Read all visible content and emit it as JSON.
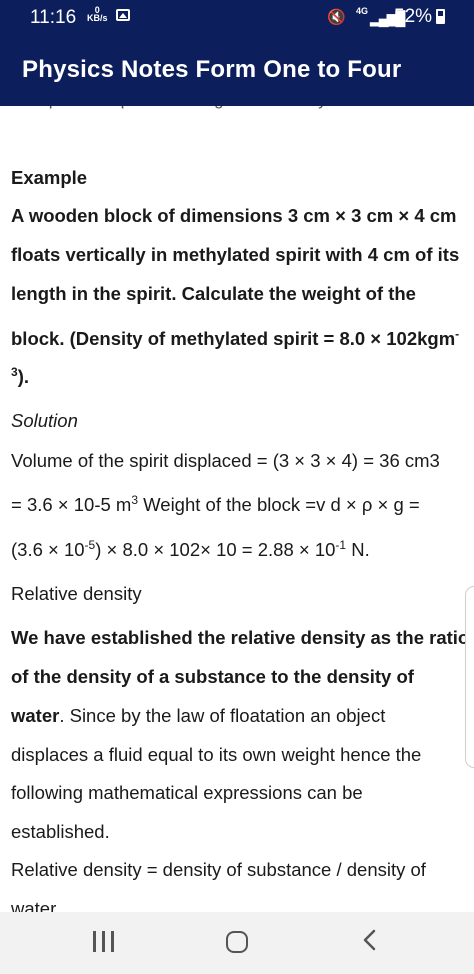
{
  "status_bar": {
    "time": "11:16",
    "net_speed_value": "0",
    "net_speed_unit": "KB/s",
    "network": "4G",
    "battery": "52%"
  },
  "app_bar": {
    "title": "Physics Notes Form One to Four"
  },
  "content": {
    "cut_line": "the upthrust equals the weight of the body.",
    "example_heading": "Example",
    "example_lines": [
      "A wooden block of dimensions 3 cm × 3 cm × 4 cm",
      "floats vertically in methylated spirit with 4 cm of its",
      "length in the spirit. Calculate the weight of the",
      "block. (Density of methylated spirit = 8.0 × 102kgm"
    ],
    "example_sup": "-",
    "example_last_sup": "3",
    "example_last_tail": ").",
    "solution_label": "Solution",
    "sol_line1": "Volume of the spirit displaced = (3 × 3 × 4) = 36 cm3",
    "sol_line2_a": "= 3.6 × 10-5 m",
    "sol_line2_sup": "3",
    "sol_line2_b": " Weight of the block =v d × ρ × g =",
    "sol_line3_a": "(3.6 × 10",
    "sol_line3_sup1": "-5",
    "sol_line3_b": ") × 8.0 × 102× 10 = 2.88 × 10",
    "sol_line3_sup2": "-1",
    "sol_line3_c": " N.",
    "relative_density_heading": "Relative density",
    "rd_bold_1": "We have established the relative density as the ratio",
    "rd_bold_2": "of the density of a substance to the density of",
    "rd_bold_3": "water",
    "rd_plain_3": ". Since by the law of floatation an object",
    "rd_line4": "displaces a fluid equal to its own weight hence the",
    "rd_line5": "following mathematical expressions can be",
    "rd_line6": "established.",
    "rd_formula": "Relative density = density of substance / density of",
    "rd_formula_cut": "water"
  }
}
